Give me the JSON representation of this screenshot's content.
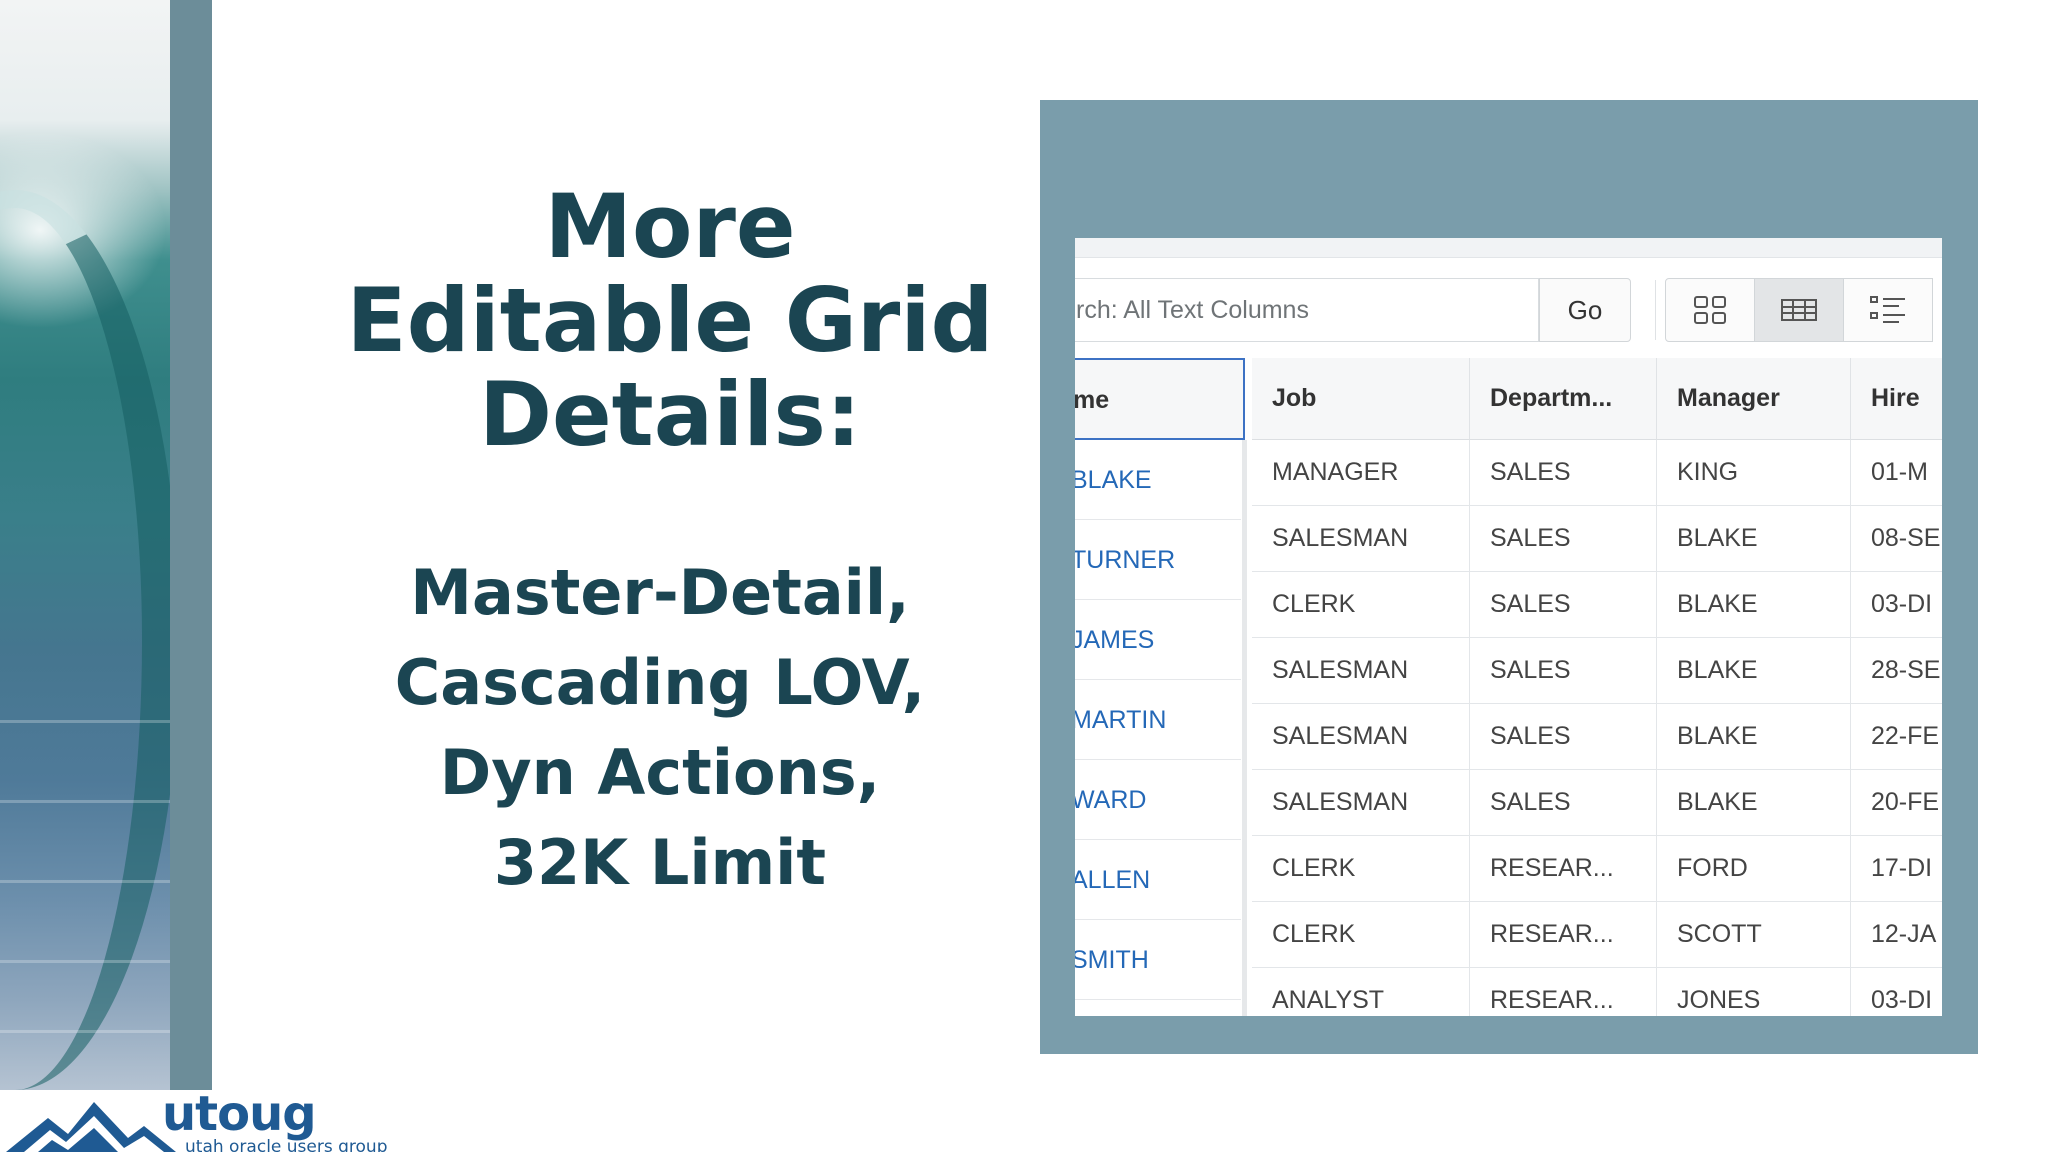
{
  "slide": {
    "title_lines": [
      "More",
      "Editable Grid",
      "Details:"
    ],
    "subtitle_lines": [
      "Master-Detail,",
      "Cascading LOV,",
      "Dyn Actions,",
      "32K Limit"
    ]
  },
  "logo": {
    "word": "utoug",
    "tagline": "utah oracle users group"
  },
  "toolbar": {
    "search_placeholder": "rch: All Text Columns",
    "go_label": "Go",
    "views": [
      {
        "icon": "icon-view-icon",
        "active": false
      },
      {
        "icon": "grid-view-icon",
        "active": true
      },
      {
        "icon": "detail-view-icon",
        "active": false
      }
    ]
  },
  "grid": {
    "columns": [
      "me",
      "Job",
      "Departm...",
      "Manager",
      "Hire"
    ],
    "names": [
      "BLAKE",
      "TURNER",
      "JAMES",
      "MARTIN",
      "WARD",
      "ALLEN",
      "SMITH"
    ],
    "rows": [
      [
        "MANAGER",
        "SALES",
        "KING",
        "01-M"
      ],
      [
        "SALESMAN",
        "SALES",
        "BLAKE",
        "08-SE"
      ],
      [
        "CLERK",
        "SALES",
        "BLAKE",
        "03-DI"
      ],
      [
        "SALESMAN",
        "SALES",
        "BLAKE",
        "28-SE"
      ],
      [
        "SALESMAN",
        "SALES",
        "BLAKE",
        "22-FE"
      ],
      [
        "SALESMAN",
        "SALES",
        "BLAKE",
        "20-FE"
      ],
      [
        "CLERK",
        "RESEAR...",
        "FORD",
        "17-DI"
      ],
      [
        "CLERK",
        "RESEAR...",
        "SCOTT",
        "12-JA"
      ],
      [
        "ANALYST",
        "RESEAR...",
        "JONES",
        "03-DI"
      ]
    ]
  },
  "colors": {
    "title": "#1b4552",
    "frame": "#7a9dab",
    "link": "#2468b7",
    "logo": "#1f5a93"
  }
}
